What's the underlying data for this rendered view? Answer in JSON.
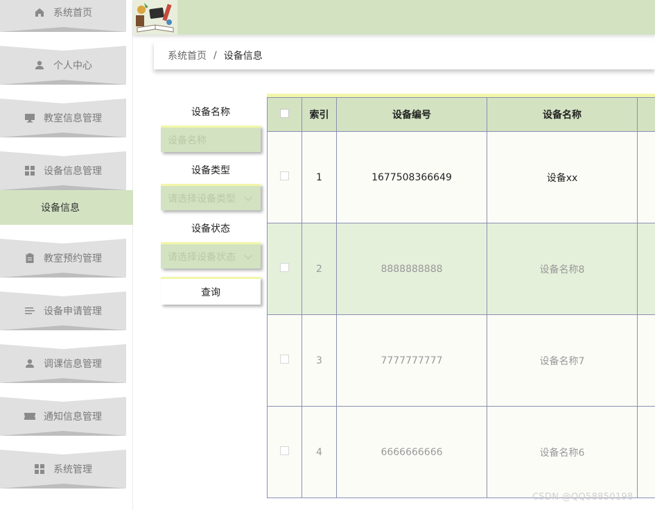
{
  "sidebar": {
    "items": [
      {
        "label": "系统首页",
        "icon": "home-icon"
      },
      {
        "label": "个人中心",
        "icon": "user-icon"
      },
      {
        "label": "教室信息管理",
        "icon": "monitor-icon"
      },
      {
        "label": "设备信息管理",
        "icon": "grid-icon"
      },
      {
        "label": "教室预约管理",
        "icon": "clipboard-icon"
      },
      {
        "label": "设备申请管理",
        "icon": "list-icon"
      },
      {
        "label": "调课信息管理",
        "icon": "user-icon"
      },
      {
        "label": "通知信息管理",
        "icon": "ticket-icon"
      },
      {
        "label": "系统管理",
        "icon": "grid-icon"
      }
    ],
    "active_submenu": "设备信息"
  },
  "breadcrumb": {
    "home": "系统首页",
    "separator": "/",
    "current": "设备信息"
  },
  "search": {
    "name_label": "设备名称",
    "name_placeholder": "设备名称",
    "type_label": "设备类型",
    "type_placeholder": "请选择设备类型",
    "status_label": "设备状态",
    "status_placeholder": "请选择设备状态",
    "button": "查询"
  },
  "table": {
    "headers": {
      "index": "索引",
      "code": "设备编号",
      "name": "设备名称"
    },
    "rows": [
      {
        "index": "1",
        "code": "1677508366649",
        "name": "设备xx"
      },
      {
        "index": "2",
        "code": "8888888888",
        "name": "设备名称8"
      },
      {
        "index": "3",
        "code": "7777777777",
        "name": "设备名称7"
      },
      {
        "index": "4",
        "code": "6666666666",
        "name": "设备名称6"
      }
    ]
  },
  "watermark": "CSDN @QQ58850198",
  "colors": {
    "accent": "#d3e3c2",
    "highlight_row": "#e5f0db",
    "border_top": "#f2f6a8",
    "sidebar_item": "#e0e0e0"
  }
}
